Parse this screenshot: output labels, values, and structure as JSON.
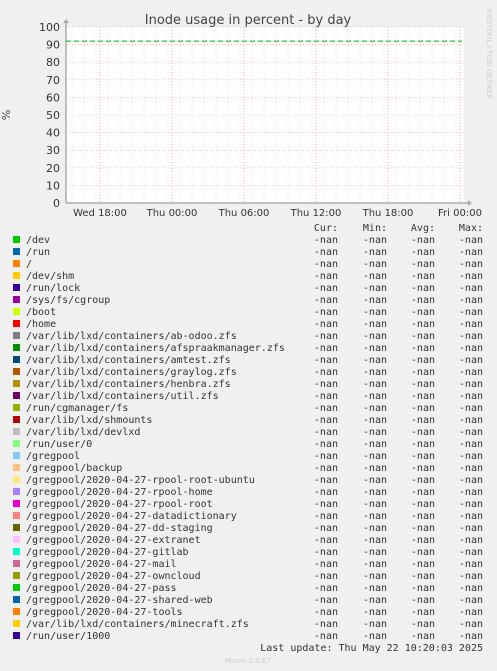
{
  "chart_data": {
    "type": "line",
    "title": "Inode usage in percent - by day",
    "ylabel": "%",
    "ylim": [
      0,
      100
    ],
    "y_ticks": [
      "0",
      "10",
      "20",
      "30",
      "40",
      "50",
      "60",
      "70",
      "80",
      "90",
      "100"
    ],
    "x_ticks": [
      "Wed 18:00",
      "Thu 00:00",
      "Thu 06:00",
      "Thu 12:00",
      "Thu 18:00",
      "Fri 00:00"
    ],
    "grid": true,
    "warning_line": {
      "value": 92,
      "color": "#00aa00"
    },
    "side_label": "RRDTOOL / TOBI OETIKER",
    "legend_headers": [
      "Cur:",
      "Min:",
      "Avg:",
      "Max:"
    ],
    "series": [
      {
        "name": "/dev",
        "color": "#00cc00",
        "cur": "-nan",
        "min": "-nan",
        "avg": "-nan",
        "max": "-nan"
      },
      {
        "name": "/run",
        "color": "#0066b3",
        "cur": "-nan",
        "min": "-nan",
        "avg": "-nan",
        "max": "-nan"
      },
      {
        "name": "/",
        "color": "#ff8000",
        "cur": "-nan",
        "min": "-nan",
        "avg": "-nan",
        "max": "-nan"
      },
      {
        "name": "/dev/shm",
        "color": "#ffcc00",
        "cur": "-nan",
        "min": "-nan",
        "avg": "-nan",
        "max": "-nan"
      },
      {
        "name": "/run/lock",
        "color": "#330099",
        "cur": "-nan",
        "min": "-nan",
        "avg": "-nan",
        "max": "-nan"
      },
      {
        "name": "/sys/fs/cgroup",
        "color": "#990099",
        "cur": "-nan",
        "min": "-nan",
        "avg": "-nan",
        "max": "-nan"
      },
      {
        "name": "/boot",
        "color": "#ccff00",
        "cur": "-nan",
        "min": "-nan",
        "avg": "-nan",
        "max": "-nan"
      },
      {
        "name": "/home",
        "color": "#ff0000",
        "cur": "-nan",
        "min": "-nan",
        "avg": "-nan",
        "max": "-nan"
      },
      {
        "name": "/var/lib/lxd/containers/ab-odoo.zfs",
        "color": "#808080",
        "cur": "-nan",
        "min": "-nan",
        "avg": "-nan",
        "max": "-nan"
      },
      {
        "name": "/var/lib/lxd/containers/afspraakmanager.zfs",
        "color": "#008f00",
        "cur": "-nan",
        "min": "-nan",
        "avg": "-nan",
        "max": "-nan"
      },
      {
        "name": "/var/lib/lxd/containers/amtest.zfs",
        "color": "#00487d",
        "cur": "-nan",
        "min": "-nan",
        "avg": "-nan",
        "max": "-nan"
      },
      {
        "name": "/var/lib/lxd/containers/graylog.zfs",
        "color": "#b35a00",
        "cur": "-nan",
        "min": "-nan",
        "avg": "-nan",
        "max": "-nan"
      },
      {
        "name": "/var/lib/lxd/containers/henbra.zfs",
        "color": "#b38f00",
        "cur": "-nan",
        "min": "-nan",
        "avg": "-nan",
        "max": "-nan"
      },
      {
        "name": "/var/lib/lxd/containers/util.zfs",
        "color": "#6b006b",
        "cur": "-nan",
        "min": "-nan",
        "avg": "-nan",
        "max": "-nan"
      },
      {
        "name": "/run/cgmanager/fs",
        "color": "#8fb300",
        "cur": "-nan",
        "min": "-nan",
        "avg": "-nan",
        "max": "-nan"
      },
      {
        "name": "/var/lib/lxd/shmounts",
        "color": "#b30000",
        "cur": "-nan",
        "min": "-nan",
        "avg": "-nan",
        "max": "-nan"
      },
      {
        "name": "/var/lib/lxd/devlxd",
        "color": "#bebebe",
        "cur": "-nan",
        "min": "-nan",
        "avg": "-nan",
        "max": "-nan"
      },
      {
        "name": "/run/user/0",
        "color": "#80ff80",
        "cur": "-nan",
        "min": "-nan",
        "avg": "-nan",
        "max": "-nan"
      },
      {
        "name": "/gregpool",
        "color": "#80c9ff",
        "cur": "-nan",
        "min": "-nan",
        "avg": "-nan",
        "max": "-nan"
      },
      {
        "name": "/gregpool/backup",
        "color": "#ffc080",
        "cur": "-nan",
        "min": "-nan",
        "avg": "-nan",
        "max": "-nan"
      },
      {
        "name": "/gregpool/2020-04-27-rpool-root-ubuntu",
        "color": "#ffe680",
        "cur": "-nan",
        "min": "-nan",
        "avg": "-nan",
        "max": "-nan"
      },
      {
        "name": "/gregpool/2020-04-27-rpool-home",
        "color": "#aa80ff",
        "cur": "-nan",
        "min": "-nan",
        "avg": "-nan",
        "max": "-nan"
      },
      {
        "name": "/gregpool/2020-04-27-rpool-root",
        "color": "#ee00cc",
        "cur": "-nan",
        "min": "-nan",
        "avg": "-nan",
        "max": "-nan"
      },
      {
        "name": "/gregpool/2020-04-27-datadictionary",
        "color": "#ff8080",
        "cur": "-nan",
        "min": "-nan",
        "avg": "-nan",
        "max": "-nan"
      },
      {
        "name": "/gregpool/2020-04-27-dd-staging",
        "color": "#666600",
        "cur": "-nan",
        "min": "-nan",
        "avg": "-nan",
        "max": "-nan"
      },
      {
        "name": "/gregpool/2020-04-27-extranet",
        "color": "#ffbfff",
        "cur": "-nan",
        "min": "-nan",
        "avg": "-nan",
        "max": "-nan"
      },
      {
        "name": "/gregpool/2020-04-27-gitlab",
        "color": "#00ffcc",
        "cur": "-nan",
        "min": "-nan",
        "avg": "-nan",
        "max": "-nan"
      },
      {
        "name": "/gregpool/2020-04-27-mail",
        "color": "#cc6699",
        "cur": "-nan",
        "min": "-nan",
        "avg": "-nan",
        "max": "-nan"
      },
      {
        "name": "/gregpool/2020-04-27-owncloud",
        "color": "#999900",
        "cur": "-nan",
        "min": "-nan",
        "avg": "-nan",
        "max": "-nan"
      },
      {
        "name": "/gregpool/2020-04-27-pass",
        "color": "#00cc00",
        "cur": "-nan",
        "min": "-nan",
        "avg": "-nan",
        "max": "-nan"
      },
      {
        "name": "/gregpool/2020-04-27-shared-web",
        "color": "#0066b3",
        "cur": "-nan",
        "min": "-nan",
        "avg": "-nan",
        "max": "-nan"
      },
      {
        "name": "/gregpool/2020-04-27-tools",
        "color": "#ff8000",
        "cur": "-nan",
        "min": "-nan",
        "avg": "-nan",
        "max": "-nan"
      },
      {
        "name": "/var/lib/lxd/containers/minecraft.zfs",
        "color": "#ffcc00",
        "cur": "-nan",
        "min": "-nan",
        "avg": "-nan",
        "max": "-nan"
      },
      {
        "name": "/run/user/1000",
        "color": "#330099",
        "cur": "-nan",
        "min": "-nan",
        "avg": "-nan",
        "max": "-nan"
      }
    ],
    "last_update": "Last update: Thu May 22 10:20:03 2025",
    "footer": "Munin 2.0.67"
  }
}
